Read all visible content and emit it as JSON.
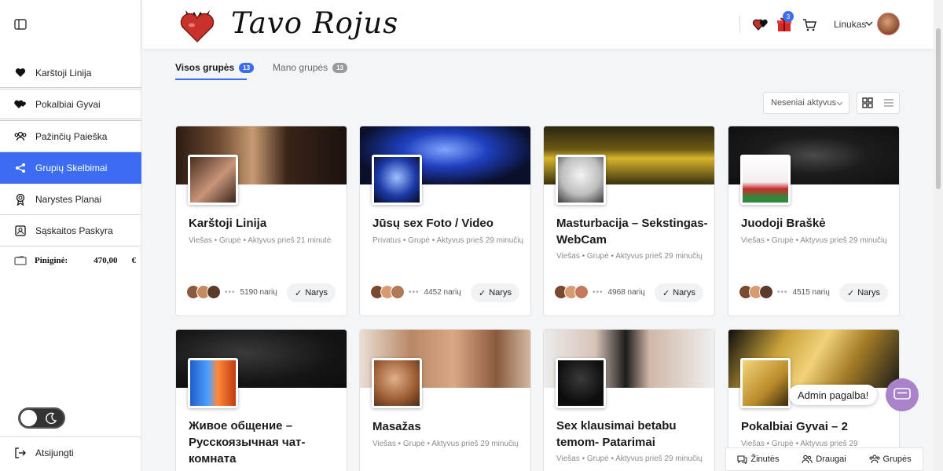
{
  "sidebar": {
    "items": [
      {
        "label": "Karštoji Linija",
        "icon": "heart-icon"
      },
      {
        "label": "Pokalbiai Gyvai",
        "icon": "hearts-icon"
      },
      {
        "label": "Pažinčių Paieška",
        "icon": "users-icon"
      },
      {
        "label": "Grupių Skelbimai",
        "icon": "share-icon",
        "active": true
      },
      {
        "label": "Narystes Planai",
        "icon": "badge-icon"
      },
      {
        "label": "Sąskaitos Paskyra",
        "icon": "account-icon"
      }
    ],
    "wallet": {
      "label": "Piniginė:",
      "amount": "470,00",
      "currency": "€"
    },
    "logout_label": "Atsijungti"
  },
  "header": {
    "logo_text": "Tavo Rojus",
    "cart_badge": "3",
    "user_name": "Linukas"
  },
  "tabs": [
    {
      "label": "Visos grupės",
      "count": "13",
      "active": true
    },
    {
      "label": "Mano grupės",
      "count": "13"
    }
  ],
  "sort": {
    "selected": "Neseniai aktyvus"
  },
  "groups": [
    {
      "title": "Karštoji Linija",
      "meta": "Viešas • Grupė • Aktyvus prieš 21 minutė",
      "members": "5190 narių",
      "button": "Narys"
    },
    {
      "title": "Jūsų sex Foto / Video",
      "meta": "Privatus • Grupė • Aktyvus prieš 29 minučių",
      "members": "4452 narių",
      "button": "Narys"
    },
    {
      "title": "Masturbacija – Sekstingas-WebCam",
      "meta": "Viešas • Grupė • Aktyvus prieš 29 minučių",
      "members": "4968 narių",
      "button": "Narys"
    },
    {
      "title": "Juodoji Braškė",
      "meta": "Viešas • Grupė • Aktyvus prieš 29 minučių",
      "members": "4515 narių",
      "button": "Narys"
    },
    {
      "title": "Живое общение – Русскоязычная чат-комната",
      "meta": ""
    },
    {
      "title": "Masažas",
      "meta": "Viešas • Grupė • Aktyvus prieš 29 minučių"
    },
    {
      "title": "Sex klausimai betabu temom- Patarimai",
      "meta": "Viešas • Grupė • Aktyvus prieš 29 minučių"
    },
    {
      "title": "Pokalbiai Gyvai – 2",
      "meta": "Viešas • Grupė • Aktyvus prieš 29"
    }
  ],
  "floating": {
    "admin_help": "Admin pagalba!",
    "bottom_bar": [
      "Žinutės",
      "Draugai",
      "Grupės"
    ]
  },
  "colors": {
    "accent": "#3b6cf2",
    "chat_fab": "#a982c9"
  }
}
